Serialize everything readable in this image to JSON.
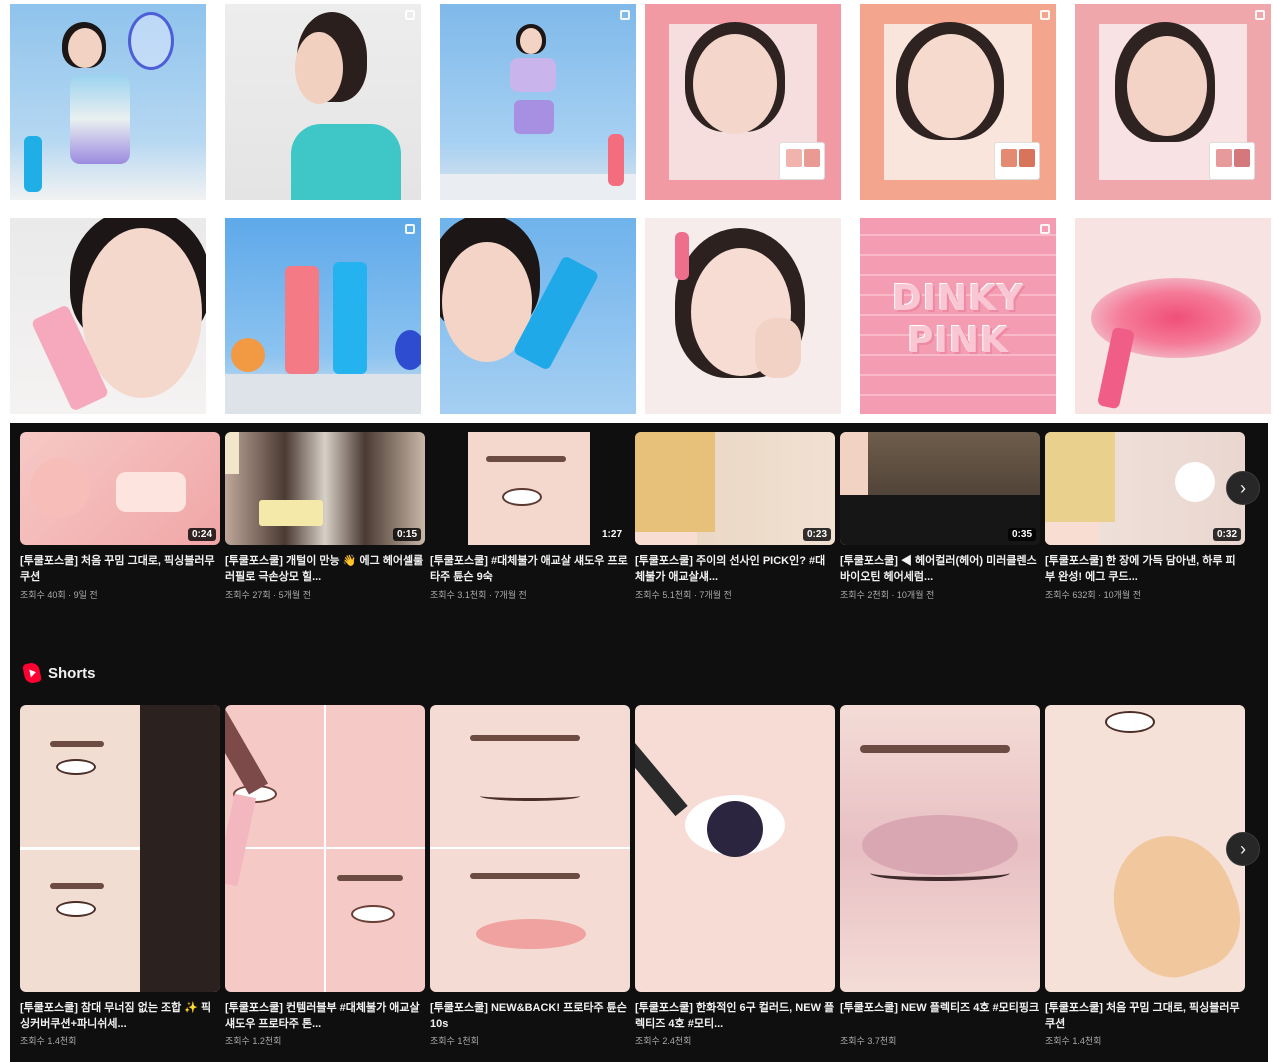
{
  "instagram": {
    "tiles": [
      {
        "name": "post-tennis-racket"
      },
      {
        "name": "post-profile-side"
      },
      {
        "name": "post-jump-pastel"
      },
      {
        "name": "post-palette-1"
      },
      {
        "name": "post-palette-2"
      },
      {
        "name": "post-palette-3"
      },
      {
        "name": "post-tube-cheek"
      },
      {
        "name": "post-tubes-sky"
      },
      {
        "name": "post-tube-face"
      },
      {
        "name": "post-wink"
      },
      {
        "name": "post-dinky-pink"
      },
      {
        "name": "post-lips"
      }
    ],
    "dinky_text": "DINKY PINK"
  },
  "videos": [
    {
      "title": "[투쿨포스쿨] 처음 꾸밈 그대로, 픽싱블러무쿠션",
      "meta": "조회수 40회 · 9일 전",
      "duration": "0:24"
    },
    {
      "title": "[투쿨포스쿨] 개털이 만능 👋 에그 헤어셀룰러필로 극손상모 힐...",
      "meta": "조회수 27회 · 5개월 전",
      "duration": "0:15"
    },
    {
      "title": "[투쿨포스쿨] #대체불가 애교살 섀도우 프로타주 튠슨 9숙",
      "meta": "조회수 3.1천회 · 7개월 전",
      "duration": "1:27"
    },
    {
      "title": "[투쿨포스쿨] 주이의 선사인 PICK인? #대체불가 애교살섀...",
      "meta": "조회수 5.1천회 · 7개월 전",
      "duration": "0:23"
    },
    {
      "title": "[투쿨포스쿨] ◀ 헤어컬러(헤어) 미러클렌스 바이오틴 헤어세럼...",
      "meta": "조회수 2천회 · 10개월 전",
      "duration": "0:35"
    },
    {
      "title": "[투쿨포스쿨] 한 장에 가득 담아낸, 하루 피부 완성! 에그 쿠드...",
      "meta": "조회수 632회 · 10개월 전",
      "duration": "0:32"
    }
  ],
  "shorts": {
    "header": "Shorts",
    "items": [
      {
        "title": "[투쿨포스쿨] 참대 무너짐 없는 조합 ✨ 픽싱커버쿠션+파니쉬세...",
        "meta": "조회수 1.4천회"
      },
      {
        "title": "[투쿨포스쿨] 컨템러블부 #대체불가 애교살섀도우 프로타주 톤...",
        "meta": "조회수 1.2천회"
      },
      {
        "title": "[투쿨포스쿨] NEW&BACK! 프로타주 튠슨 10s",
        "meta": "조회수 1천회"
      },
      {
        "title": "[투쿨포스쿨] 한화적인 6구 컬러드, NEW 플렉티즈 4호 #모티...",
        "meta": "조회수 2.4천회"
      },
      {
        "title": "[투쿨포스쿨] NEW 플렉티즈 4호 #모티핑크",
        "meta": "조회수 3.7천회"
      },
      {
        "title": "[투쿨포스쿨] 처음 꾸밈 그대로, 픽싱블러무쿠션",
        "meta": "조회수 1.4천회"
      }
    ]
  },
  "colors": {
    "yt_bg": "#0f0f0f",
    "accent": "#ff0033",
    "text": "#f1f1f1",
    "meta": "#aaaaaa"
  },
  "icons": {
    "next": "chevron-right-icon",
    "multi": "multi-post-icon",
    "shorts": "shorts-logo-icon"
  }
}
